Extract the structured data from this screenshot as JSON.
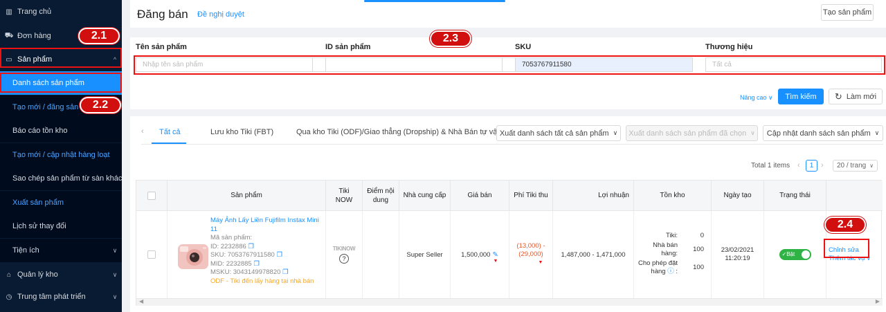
{
  "sidebar": {
    "items": [
      {
        "label": "Trang chủ",
        "icon": "chart-icon"
      },
      {
        "label": "Đơn hàng",
        "icon": "cart-icon"
      },
      {
        "label": "Sản phẩm",
        "icon": "laptop-icon",
        "chevron": "^"
      },
      {
        "label": "Danh sách sản phẩm"
      },
      {
        "label": "Tạo mới / đăng sản phẩm"
      },
      {
        "label": "Báo cáo tồn kho"
      },
      {
        "label": "Tạo mới / cập nhật hàng loạt"
      },
      {
        "label": "Sao chép sản phẩm từ sàn khác"
      },
      {
        "label": "Xuất sản phẩm"
      },
      {
        "label": "Lịch sử thay đổi"
      },
      {
        "label": "Tiện ích",
        "chevron": "v"
      },
      {
        "label": "Quản lý kho",
        "icon": "home-icon",
        "chevron": "v"
      },
      {
        "label": "Trung tâm phát triển",
        "icon": "clock-icon",
        "chevron": "v"
      }
    ]
  },
  "header": {
    "title": "Đăng bán",
    "subtitle": "Đề nghị duyệt",
    "create_button": "Tạo sản phẩm"
  },
  "filter": {
    "name_label": "Tên sản phẩm",
    "name_placeholder": "Nhập tên sản phẩm",
    "id_label": "ID sản phẩm",
    "id_value": "",
    "sku_label": "SKU",
    "sku_value": "7053767911580",
    "brand_label": "Thương hiệu",
    "brand_placeholder": "Tất cả",
    "advanced": "Nâng cao ∨",
    "search_button": "Tìm kiếm",
    "reset_button": "Làm mới"
  },
  "tabs": [
    "Tất cả",
    "Lưu kho Tiki (FBT)",
    "Qua kho Tiki (ODF)/Giao thẳng (Dropship) & Nhà Bán tự vậ"
  ],
  "actions": {
    "export_all": "Xuất danh sách tất cả sản phẩm",
    "export_selected": "Xuất danh sách sản phẩm đã chọn",
    "update_list": "Cập nhật danh sách sản phẩm"
  },
  "pagination": {
    "total": "Total 1 items",
    "page": "1",
    "per_page": "20 / trang"
  },
  "table": {
    "headers": [
      "Sản phẩm",
      "Tiki NOW",
      "Điểm nội dung",
      "Nhà cung cấp",
      "Giá bán",
      "Phí Tiki thu",
      "Lợi nhuận",
      "Tồn kho",
      "Ngày tạo",
      "Trạng thái"
    ],
    "row": {
      "name": "Máy Ảnh Lấy Liền Fujifilm Instax Mini 11",
      "code_label": "Mã sản phẩm:",
      "id": "ID: 2232886",
      "sku": "SKU: 7053767911580",
      "mid": "MID: 2232885",
      "msku": "MSKU: 3043149978820",
      "fulfillment": "ODF - Tiki đến lấy hàng tại nhà bán",
      "tikinow": "TIKINOW",
      "supplier": "Super Seller",
      "price": "1,500,000",
      "fee_1": "(13,000) -",
      "fee_2": "(29,000)",
      "profit": "1,487,000 - 1,471,000",
      "stock_tiki_label": "Tiki:",
      "stock_tiki": "0",
      "stock_seller_label": "Nhà bán hàng:",
      "stock_seller": "100",
      "stock_allow_label": "Cho phép đặt hàng",
      "stock_allow": "100",
      "date": "23/02/2021",
      "time": "11:20:19",
      "status": "Bật",
      "edit": "Chỉnh sửa",
      "more": "Thêm tác vụ"
    }
  },
  "annotations": [
    "2.1",
    "2.2",
    "2.3",
    "2.4"
  ],
  "colors": {
    "sidebar": "#091b32",
    "accent": "#1890ff",
    "annotation": "#d20f0f",
    "toggle": "#2fb344"
  }
}
